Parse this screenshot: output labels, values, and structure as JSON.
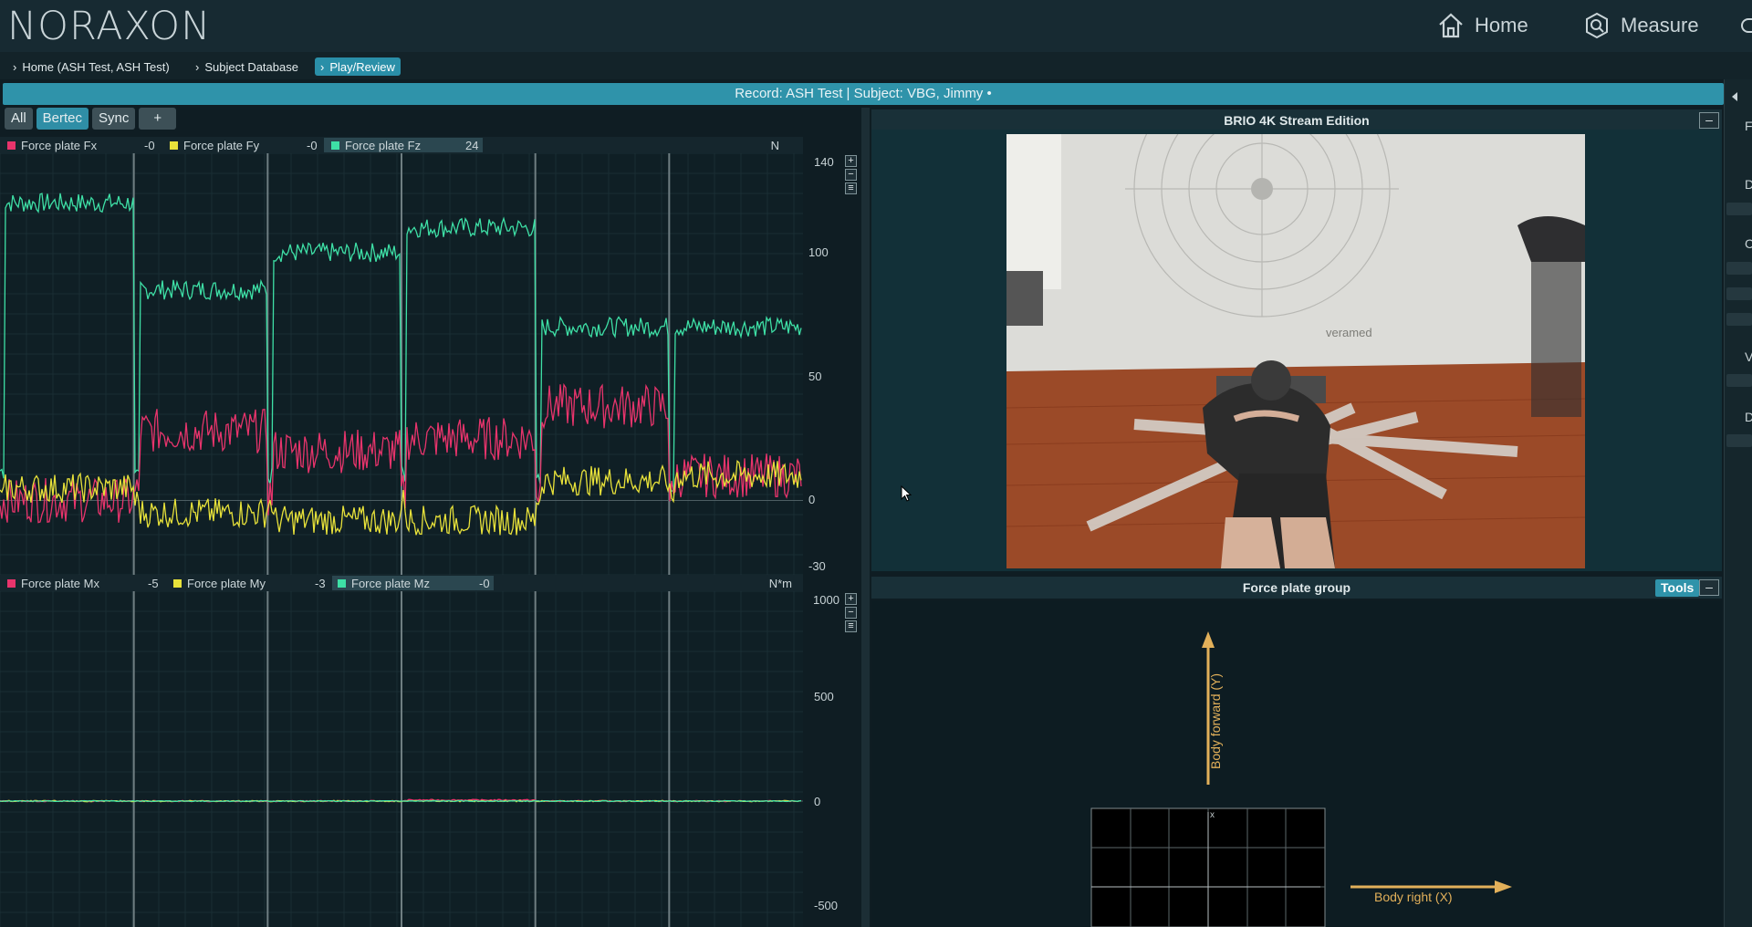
{
  "app": {
    "logo": "NORAXON"
  },
  "nav": {
    "home": "Home",
    "measure": "Measure"
  },
  "breadcrumb": [
    "Home (ASH Test, ASH Test)",
    "Subject Database",
    "Play/Review"
  ],
  "record_bar": "Record: ASH Test | Subject: VBG, Jimmy •",
  "toolbar": {
    "all": "All",
    "bertec": "Bertec",
    "sync": "Sync",
    "add": "+"
  },
  "force_chart": {
    "legend": [
      {
        "name": "Force plate Fx",
        "value": "-0",
        "color": "#e8346c"
      },
      {
        "name": "Force plate Fy",
        "value": "-0",
        "color": "#e8e23a"
      },
      {
        "name": "Force plate Fz",
        "value": "24",
        "color": "#3ee0a6"
      }
    ],
    "unit": "N",
    "ticks": [
      "140",
      "100",
      "50",
      "0",
      "-30"
    ]
  },
  "moment_chart": {
    "legend": [
      {
        "name": "Force plate Mx",
        "value": "-5",
        "color": "#e8346c"
      },
      {
        "name": "Force plate My",
        "value": "-3",
        "color": "#e8e23a"
      },
      {
        "name": "Force plate Mz",
        "value": "-0",
        "color": "#3ee0a6"
      }
    ],
    "unit": "N*m",
    "ticks": [
      "1000",
      "500",
      "0",
      "-500"
    ]
  },
  "zoom_controls": {
    "plus": "+",
    "minus": "−",
    "fit": "≡"
  },
  "video_panel": {
    "title": "BRIO 4K Stream Edition",
    "wall_brand": "veramed"
  },
  "forceplate_panel": {
    "title": "Force plate group",
    "tools": "Tools",
    "axis_y": "Body forward (Y)",
    "axis_x": "Body right (X)",
    "mini_x": "x"
  },
  "right_panel": {
    "letters": [
      "F",
      "D",
      "C",
      "V",
      "D"
    ]
  },
  "chart_data": [
    {
      "type": "line",
      "unit": "N",
      "ylim": [
        -30,
        140
      ],
      "series": [
        {
          "name": "Force plate Fz",
          "approx_levels": [
            120,
            85,
            100,
            110,
            70,
            70
          ]
        },
        {
          "name": "Force plate Fx",
          "approx_levels": [
            0,
            28,
            20,
            25,
            38,
            10
          ]
        },
        {
          "name": "Force plate Fy",
          "approx_levels": [
            5,
            -5,
            -8,
            -8,
            8,
            10
          ]
        }
      ]
    },
    {
      "type": "line",
      "unit": "N*m",
      "ylim": [
        -600,
        1000
      ],
      "series": [
        {
          "name": "Force plate Mx",
          "approx_levels": [
            0,
            0,
            0,
            5,
            0,
            0
          ]
        },
        {
          "name": "Force plate My",
          "approx_levels": [
            0,
            0,
            0,
            0,
            0,
            0
          ]
        },
        {
          "name": "Force plate Mz",
          "approx_levels": [
            0,
            0,
            0,
            0,
            0,
            0
          ]
        }
      ]
    }
  ]
}
